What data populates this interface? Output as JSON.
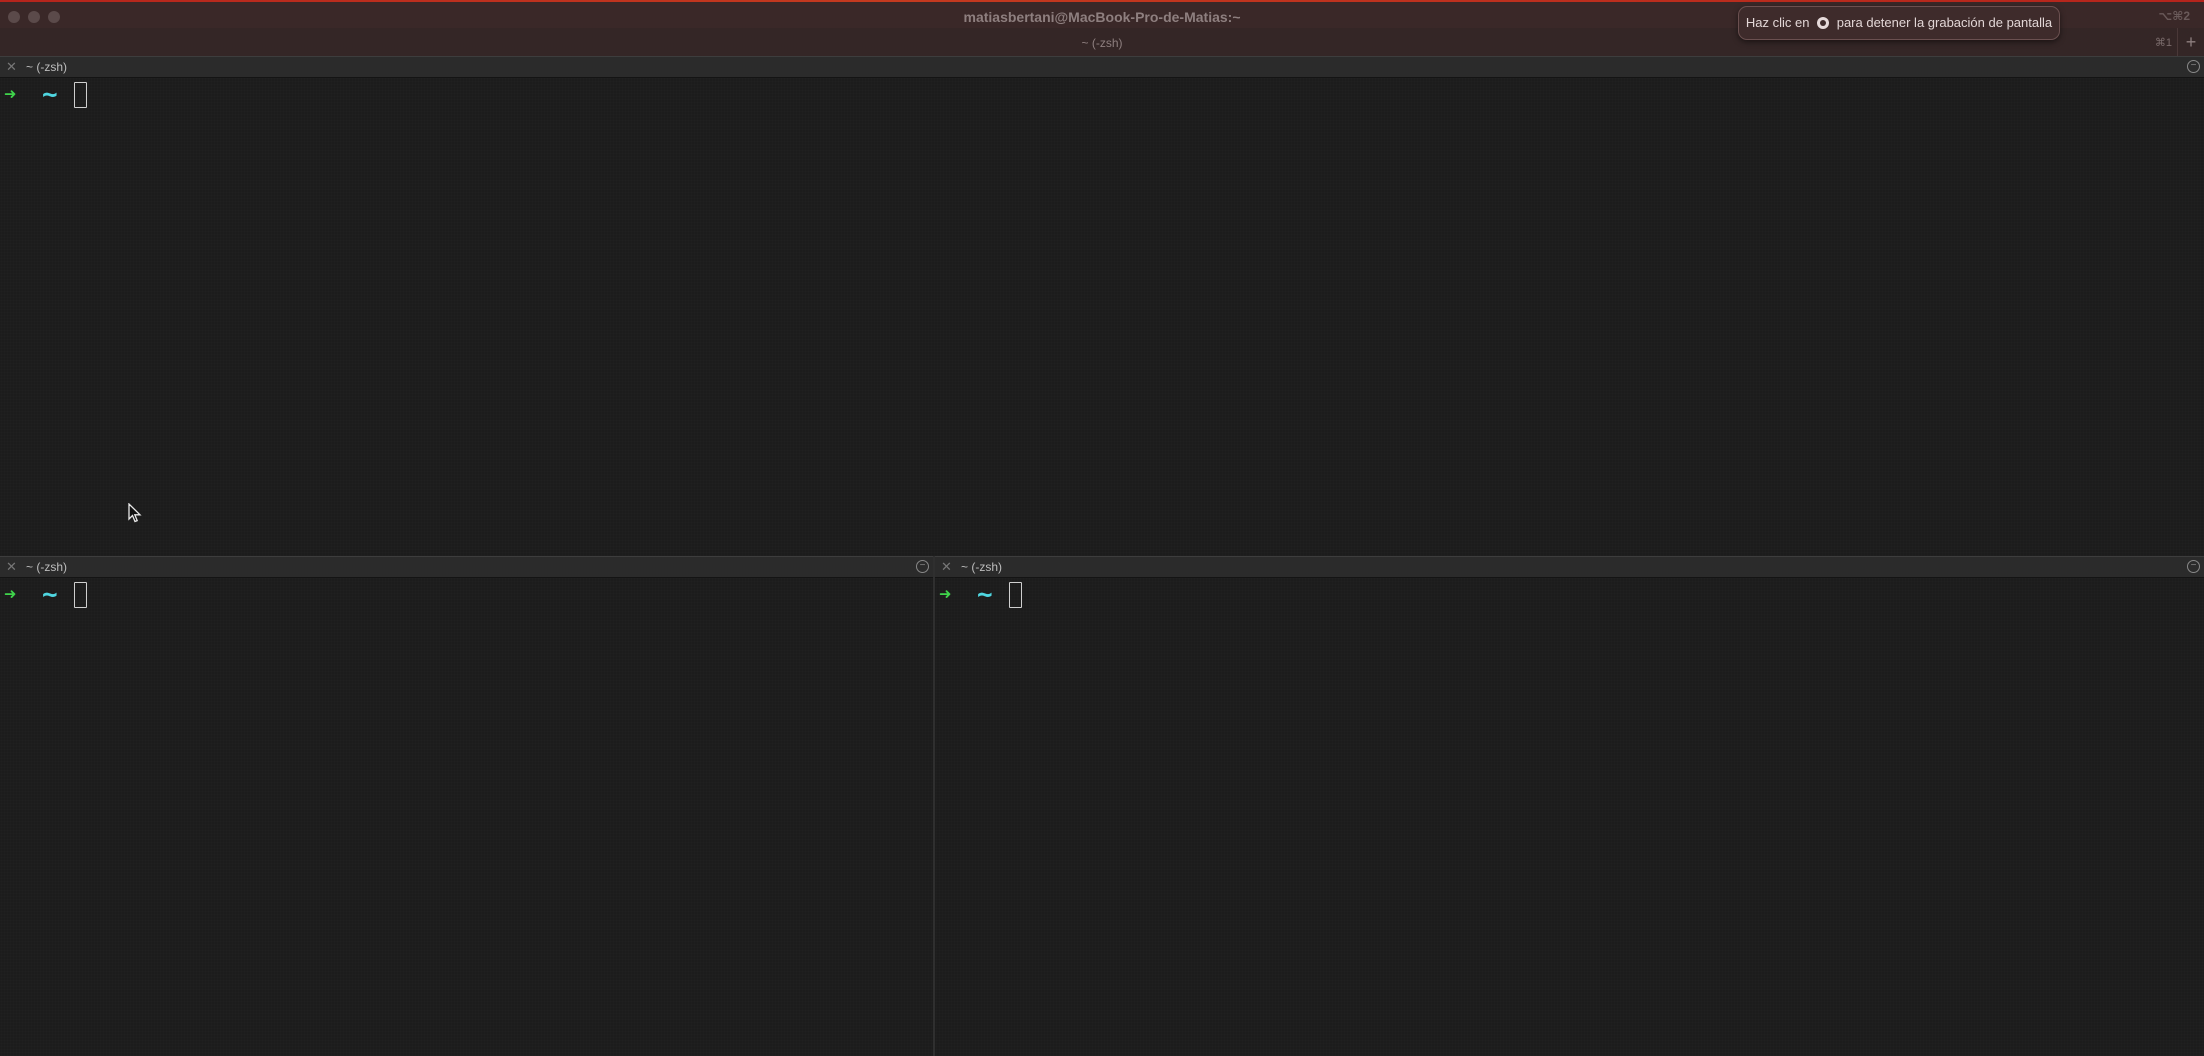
{
  "window": {
    "title": "matiasbertani@MacBook-Pro-de-Matias:~",
    "tab_title": "~ (-zsh)",
    "window_shortcut": "⌥⌘2",
    "tab_shortcut": "⌘1",
    "new_tab_label": "+"
  },
  "recording_banner": {
    "text_before": "Haz clic en",
    "text_after": "para detener la grabación de pantalla"
  },
  "panes": [
    {
      "title": "~ (-zsh)",
      "prompt_symbol": "➜",
      "cwd": "~"
    },
    {
      "title": "~ (-zsh)",
      "prompt_symbol": "➜",
      "cwd": "~"
    },
    {
      "title": "~ (-zsh)",
      "prompt_symbol": "➜",
      "cwd": "~"
    }
  ],
  "icons": {
    "close": "close-icon",
    "maximize": "maximize-icon",
    "record_stop": "record-stop-icon",
    "mouse_pointer": "mouse-pointer-icon"
  },
  "colors": {
    "accent": "#b5241c",
    "prompt_arrow": "#3fd44b",
    "prompt_cwd": "#4fd6e0"
  }
}
